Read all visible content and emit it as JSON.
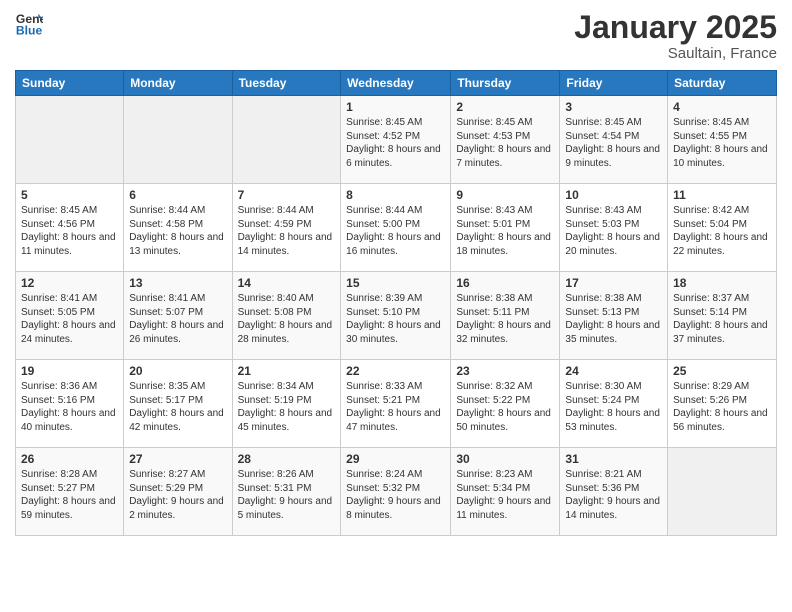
{
  "header": {
    "logo_line1": "General",
    "logo_line2": "Blue",
    "title": "January 2025",
    "subtitle": "Saultain, France"
  },
  "weekdays": [
    "Sunday",
    "Monday",
    "Tuesday",
    "Wednesday",
    "Thursday",
    "Friday",
    "Saturday"
  ],
  "weeks": [
    [
      {
        "day": "",
        "detail": ""
      },
      {
        "day": "",
        "detail": ""
      },
      {
        "day": "",
        "detail": ""
      },
      {
        "day": "1",
        "detail": "Sunrise: 8:45 AM\nSunset: 4:52 PM\nDaylight: 8 hours\nand 6 minutes."
      },
      {
        "day": "2",
        "detail": "Sunrise: 8:45 AM\nSunset: 4:53 PM\nDaylight: 8 hours\nand 7 minutes."
      },
      {
        "day": "3",
        "detail": "Sunrise: 8:45 AM\nSunset: 4:54 PM\nDaylight: 8 hours\nand 9 minutes."
      },
      {
        "day": "4",
        "detail": "Sunrise: 8:45 AM\nSunset: 4:55 PM\nDaylight: 8 hours\nand 10 minutes."
      }
    ],
    [
      {
        "day": "5",
        "detail": "Sunrise: 8:45 AM\nSunset: 4:56 PM\nDaylight: 8 hours\nand 11 minutes."
      },
      {
        "day": "6",
        "detail": "Sunrise: 8:44 AM\nSunset: 4:58 PM\nDaylight: 8 hours\nand 13 minutes."
      },
      {
        "day": "7",
        "detail": "Sunrise: 8:44 AM\nSunset: 4:59 PM\nDaylight: 8 hours\nand 14 minutes."
      },
      {
        "day": "8",
        "detail": "Sunrise: 8:44 AM\nSunset: 5:00 PM\nDaylight: 8 hours\nand 16 minutes."
      },
      {
        "day": "9",
        "detail": "Sunrise: 8:43 AM\nSunset: 5:01 PM\nDaylight: 8 hours\nand 18 minutes."
      },
      {
        "day": "10",
        "detail": "Sunrise: 8:43 AM\nSunset: 5:03 PM\nDaylight: 8 hours\nand 20 minutes."
      },
      {
        "day": "11",
        "detail": "Sunrise: 8:42 AM\nSunset: 5:04 PM\nDaylight: 8 hours\nand 22 minutes."
      }
    ],
    [
      {
        "day": "12",
        "detail": "Sunrise: 8:41 AM\nSunset: 5:05 PM\nDaylight: 8 hours\nand 24 minutes."
      },
      {
        "day": "13",
        "detail": "Sunrise: 8:41 AM\nSunset: 5:07 PM\nDaylight: 8 hours\nand 26 minutes."
      },
      {
        "day": "14",
        "detail": "Sunrise: 8:40 AM\nSunset: 5:08 PM\nDaylight: 8 hours\nand 28 minutes."
      },
      {
        "day": "15",
        "detail": "Sunrise: 8:39 AM\nSunset: 5:10 PM\nDaylight: 8 hours\nand 30 minutes."
      },
      {
        "day": "16",
        "detail": "Sunrise: 8:38 AM\nSunset: 5:11 PM\nDaylight: 8 hours\nand 32 minutes."
      },
      {
        "day": "17",
        "detail": "Sunrise: 8:38 AM\nSunset: 5:13 PM\nDaylight: 8 hours\nand 35 minutes."
      },
      {
        "day": "18",
        "detail": "Sunrise: 8:37 AM\nSunset: 5:14 PM\nDaylight: 8 hours\nand 37 minutes."
      }
    ],
    [
      {
        "day": "19",
        "detail": "Sunrise: 8:36 AM\nSunset: 5:16 PM\nDaylight: 8 hours\nand 40 minutes."
      },
      {
        "day": "20",
        "detail": "Sunrise: 8:35 AM\nSunset: 5:17 PM\nDaylight: 8 hours\nand 42 minutes."
      },
      {
        "day": "21",
        "detail": "Sunrise: 8:34 AM\nSunset: 5:19 PM\nDaylight: 8 hours\nand 45 minutes."
      },
      {
        "day": "22",
        "detail": "Sunrise: 8:33 AM\nSunset: 5:21 PM\nDaylight: 8 hours\nand 47 minutes."
      },
      {
        "day": "23",
        "detail": "Sunrise: 8:32 AM\nSunset: 5:22 PM\nDaylight: 8 hours\nand 50 minutes."
      },
      {
        "day": "24",
        "detail": "Sunrise: 8:30 AM\nSunset: 5:24 PM\nDaylight: 8 hours\nand 53 minutes."
      },
      {
        "day": "25",
        "detail": "Sunrise: 8:29 AM\nSunset: 5:26 PM\nDaylight: 8 hours\nand 56 minutes."
      }
    ],
    [
      {
        "day": "26",
        "detail": "Sunrise: 8:28 AM\nSunset: 5:27 PM\nDaylight: 8 hours\nand 59 minutes."
      },
      {
        "day": "27",
        "detail": "Sunrise: 8:27 AM\nSunset: 5:29 PM\nDaylight: 9 hours\nand 2 minutes."
      },
      {
        "day": "28",
        "detail": "Sunrise: 8:26 AM\nSunset: 5:31 PM\nDaylight: 9 hours\nand 5 minutes."
      },
      {
        "day": "29",
        "detail": "Sunrise: 8:24 AM\nSunset: 5:32 PM\nDaylight: 9 hours\nand 8 minutes."
      },
      {
        "day": "30",
        "detail": "Sunrise: 8:23 AM\nSunset: 5:34 PM\nDaylight: 9 hours\nand 11 minutes."
      },
      {
        "day": "31",
        "detail": "Sunrise: 8:21 AM\nSunset: 5:36 PM\nDaylight: 9 hours\nand 14 minutes."
      },
      {
        "day": "",
        "detail": ""
      }
    ]
  ]
}
